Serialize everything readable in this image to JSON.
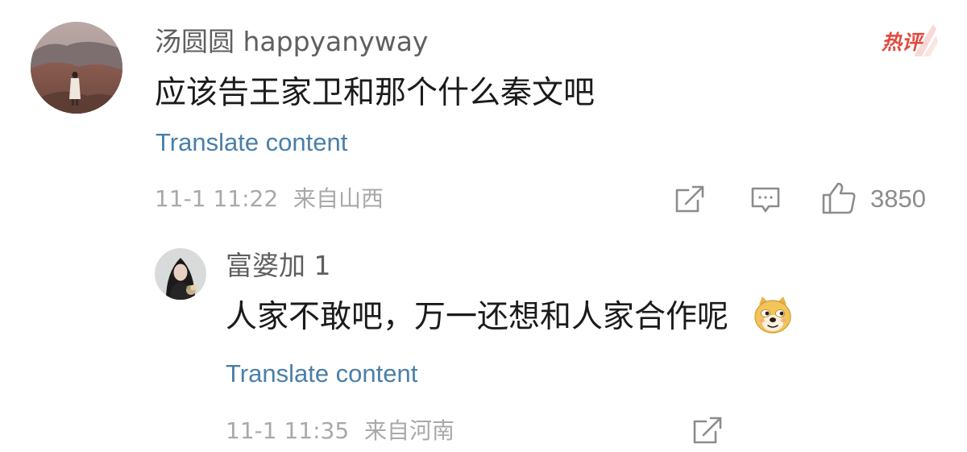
{
  "comment": {
    "username": "汤圆圆 happyanyway",
    "badge_text": "热评",
    "text": "应该告王家卫和那个什么秦文吧",
    "translate_label": "Translate content",
    "timestamp": "11-1 11:22",
    "location": "来自山西",
    "like_count": "3850",
    "icons": [
      "avatar",
      "hot-comment-badge",
      "share-icon",
      "reply-icon",
      "like-icon"
    ]
  },
  "reply": {
    "username": "富婆加 1",
    "text": "人家不敢吧，万一还想和人家合作呢",
    "emoji": "doge",
    "translate_label": "Translate content",
    "timestamp": "11-1 11:35",
    "location": "来自河南",
    "icons": [
      "avatar",
      "doge-emoji",
      "share-icon"
    ]
  },
  "colors": {
    "username": "#5f5f5f",
    "body_text": "#1b1b1b",
    "link": "#4a7fa8",
    "meta": "#a9a9a9",
    "hot_badge": "#e24a3f",
    "icon": "#8c8c8c"
  }
}
